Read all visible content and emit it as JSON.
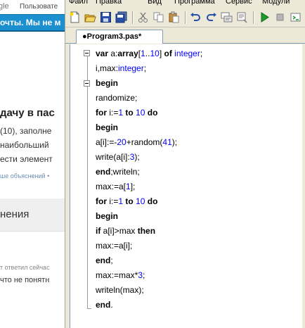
{
  "browser": {
    "logo_text": "gle",
    "user_label": "Пользовате",
    "banner": "очты. Мы не м",
    "heading": "дачу в пас",
    "line1": "(10), заполне",
    "line2": "наибольший",
    "line3": "ести элемент",
    "link": "ше объяснений  •",
    "section": "нения",
    "answer_meta": "т ответил сейчас",
    "answer_text": "что не понятн"
  },
  "menu": {
    "items": [
      "Файл",
      "Правка",
      "Вид",
      "Программа",
      "Сервис",
      "Модули"
    ]
  },
  "toolbar": {
    "icons": [
      "new-file-icon",
      "open-folder-icon",
      "save-icon",
      "save-all-icon",
      "cut-icon",
      "copy-icon",
      "paste-icon",
      "undo-icon",
      "redo-icon",
      "format-icon",
      "run-icon",
      "stop-icon",
      "compile-icon"
    ]
  },
  "tab": {
    "label": "●Program3.pas*"
  },
  "code": {
    "lines": [
      [
        {
          "t": "var ",
          "c": "k"
        },
        {
          "t": "a:"
        },
        {
          "t": "array",
          "c": "k"
        },
        {
          "t": "["
        },
        {
          "t": "1",
          "c": "n"
        },
        {
          "t": ".."
        },
        {
          "t": "10",
          "c": "n"
        },
        {
          "t": "] "
        },
        {
          "t": "of",
          "c": "k"
        },
        {
          "t": " "
        },
        {
          "t": "integer",
          "c": "ty"
        },
        {
          "t": ";"
        }
      ],
      [
        {
          "t": "i,max:"
        },
        {
          "t": "integer",
          "c": "ty"
        },
        {
          "t": ";"
        }
      ],
      [
        {
          "t": "begin",
          "c": "k"
        }
      ],
      [
        {
          "t": "randomize;"
        }
      ],
      [
        {
          "t": "for",
          "c": "k"
        },
        {
          "t": " i:="
        },
        {
          "t": "1",
          "c": "n"
        },
        {
          "t": " "
        },
        {
          "t": "to",
          "c": "k"
        },
        {
          "t": " "
        },
        {
          "t": "10",
          "c": "n"
        },
        {
          "t": " "
        },
        {
          "t": "do",
          "c": "k"
        }
      ],
      [
        {
          "t": "begin",
          "c": "k"
        }
      ],
      [
        {
          "t": "a[i]:=-"
        },
        {
          "t": "20",
          "c": "n"
        },
        {
          "t": "+random("
        },
        {
          "t": "41",
          "c": "n"
        },
        {
          "t": ");"
        }
      ],
      [
        {
          "t": "write(a[i]:"
        },
        {
          "t": "3",
          "c": "n"
        },
        {
          "t": ");"
        }
      ],
      [
        {
          "t": "end",
          "c": "k"
        },
        {
          "t": ";writeln;"
        }
      ],
      [
        {
          "t": "max:=a["
        },
        {
          "t": "1",
          "c": "n"
        },
        {
          "t": "];"
        }
      ],
      [
        {
          "t": "for",
          "c": "k"
        },
        {
          "t": " i:="
        },
        {
          "t": "1",
          "c": "n"
        },
        {
          "t": " "
        },
        {
          "t": "to",
          "c": "k"
        },
        {
          "t": " "
        },
        {
          "t": "10",
          "c": "n"
        },
        {
          "t": " "
        },
        {
          "t": "do",
          "c": "k"
        }
      ],
      [
        {
          "t": "begin",
          "c": "k"
        }
      ],
      [
        {
          "t": "if",
          "c": "k"
        },
        {
          "t": " a[i]>max "
        },
        {
          "t": "then",
          "c": "k"
        }
      ],
      [
        {
          "t": "max:=a[i];"
        }
      ],
      [
        {
          "t": "end",
          "c": "k"
        },
        {
          "t": ";"
        }
      ],
      [
        {
          "t": "max:=max*"
        },
        {
          "t": "3",
          "c": "n"
        },
        {
          "t": ";"
        }
      ],
      [
        {
          "t": "writeln(max);"
        }
      ],
      [
        {
          "t": "end",
          "c": "k"
        },
        {
          "t": "."
        }
      ]
    ]
  },
  "colors": {
    "number": "#0000ff",
    "type": "#0000ff",
    "keyword": "#000000",
    "ide_bg": "#ece9d8",
    "banner": "#1c8fd1"
  }
}
